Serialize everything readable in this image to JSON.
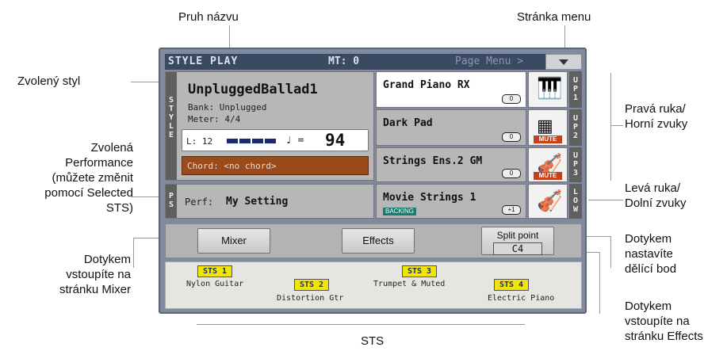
{
  "callouts": {
    "title_bar": "Pruh názvu",
    "page_menu": "Stránka menu",
    "selected_style": "Zvolený styl",
    "selected_performance": [
      "Zvolená",
      "Performance",
      "(můžete změnit",
      "pomocí Selected",
      "STS)"
    ],
    "mixer_touch": [
      "Dotykem",
      "vstoupíte na",
      "stránku Mixer"
    ],
    "right_hand": [
      "Pravá ruka/",
      "Horní zvuky"
    ],
    "left_hand": [
      "Levá ruka/",
      "Dolní zvuky"
    ],
    "split_touch": [
      "Dotykem",
      "nastavíte",
      "dělící bod"
    ],
    "effects_touch": [
      "Dotykem",
      "vstoupíte na",
      "stránku Effects"
    ],
    "sts": "STS"
  },
  "screen": {
    "title": "STYLE PLAY",
    "mt": "MT: 0",
    "page_menu": "Page Menu >",
    "style_tab": "STYLE",
    "style": {
      "name": "UnpluggedBallad1",
      "bank": "Bank:  Unplugged",
      "meter": "Meter:  4/4",
      "length": "L: 12",
      "tempo_symbol": "♩ =",
      "tempo": "94",
      "chord": "Chord: <no chord>"
    },
    "perf_tab": "PS",
    "perf_label": "Perf:",
    "perf_name": "My Setting",
    "sounds": [
      {
        "name": "Grand Piano RX",
        "octave": "0",
        "tab": "UP1",
        "icon": "🎹",
        "muted": false
      },
      {
        "name": "Dark Pad",
        "octave": "0",
        "tab": "UP2",
        "icon": "▦",
        "muted": true
      },
      {
        "name": "Strings Ens.2 GM",
        "octave": "0",
        "tab": "UP3",
        "icon": "🎻",
        "muted": true
      },
      {
        "name": "Movie Strings 1",
        "octave": "+1",
        "tab": "LOW",
        "icon": "🎻",
        "muted": false,
        "badge": "BACKING"
      }
    ],
    "mute_label": "MUTE",
    "buttons": {
      "mixer": "Mixer",
      "effects": "Effects",
      "split_title": "Split point",
      "split_value": "C4"
    },
    "sts": [
      {
        "tag": "STS 1",
        "name": "Nylon Guitar"
      },
      {
        "tag": "STS 2",
        "name": "Distortion Gtr"
      },
      {
        "tag": "STS 3",
        "name": "Trumpet & Muted"
      },
      {
        "tag": "STS 4",
        "name": "Electric Piano"
      }
    ]
  }
}
